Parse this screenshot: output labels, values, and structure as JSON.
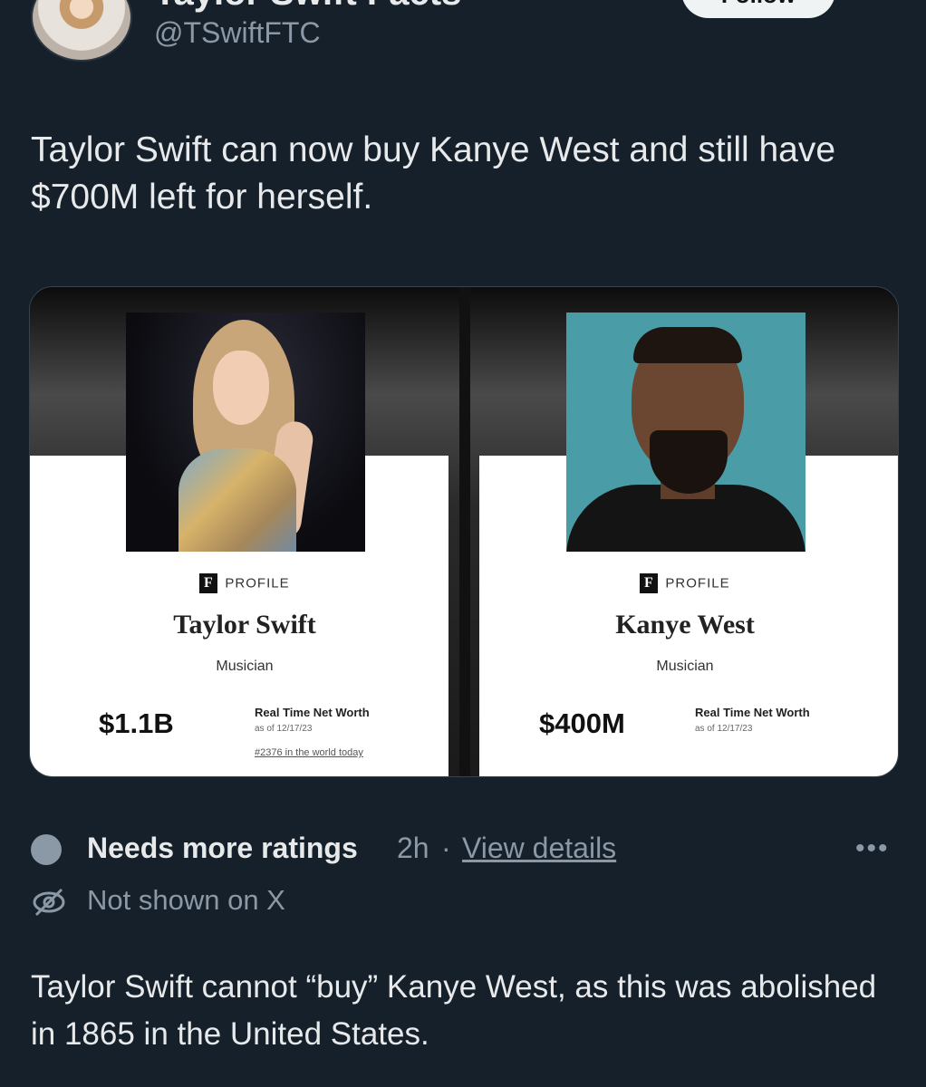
{
  "header": {
    "display_name": "Taylor Swift Facts",
    "handle": "@TSwiftFTC",
    "follow_label": "Follow"
  },
  "tweet": {
    "text": "Taylor Swift can now buy Kanye West and still have $700M left for herself."
  },
  "cards": [
    {
      "logo": "F",
      "profile_label": "PROFILE",
      "name": "Taylor Swift",
      "occupation": "Musician",
      "net_worth": "$1.1B",
      "net_worth_label": "Real Time Net Worth",
      "as_of": "as of 12/17/23",
      "rank": "#2376 in the world today"
    },
    {
      "logo": "F",
      "profile_label": "PROFILE",
      "name": "Kanye West",
      "occupation": "Musician",
      "net_worth": "$400M",
      "net_worth_label": "Real Time Net Worth",
      "as_of": "as of 12/17/23"
    }
  ],
  "community_note": {
    "status": "Needs more ratings",
    "time": "2h",
    "separator": "·",
    "details_link": "View details",
    "more_icon": "more-horizontal-icon",
    "visibility": "Not shown on X",
    "visibility_icon": "eye-off-icon",
    "body": "Taylor Swift cannot “buy” Kanye West, as this was abolished in 1865 in the United States."
  },
  "colors": {
    "background": "#15202b",
    "text_primary": "#e7e9ea",
    "text_secondary": "#8b98a5",
    "follow_bg": "#eff3f4"
  }
}
